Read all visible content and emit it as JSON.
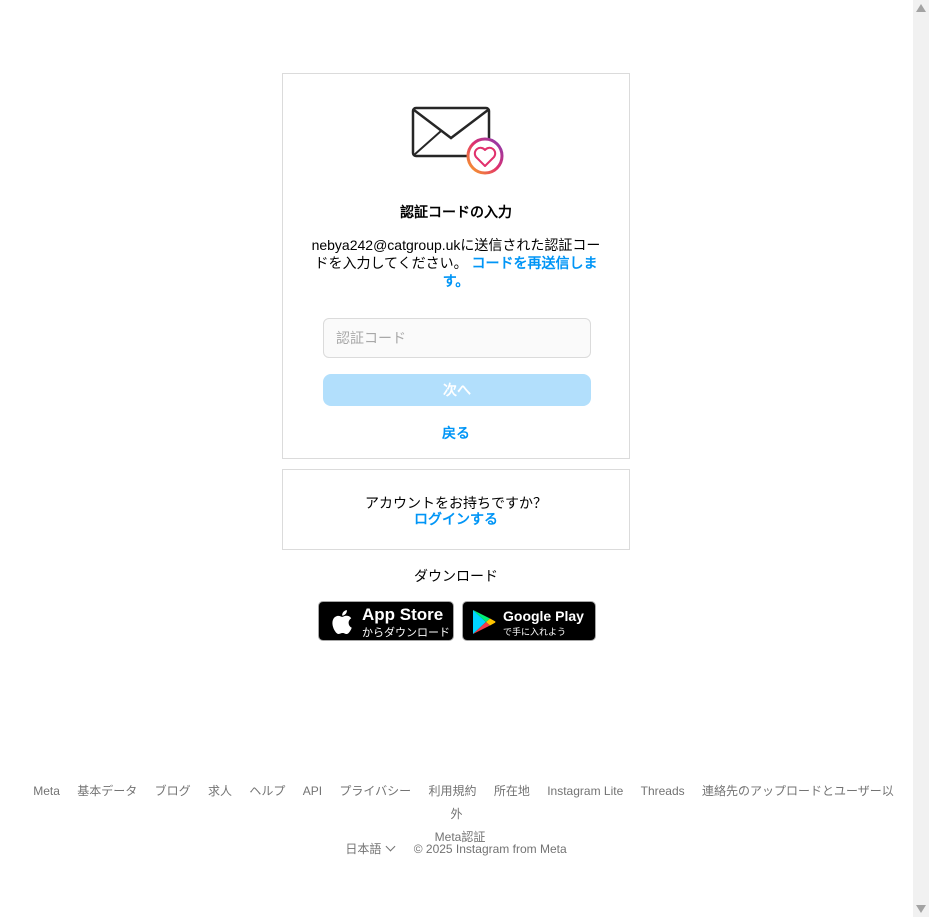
{
  "verify": {
    "title": "認証コードの入力",
    "desc_text": "nebya242@catgroup.ukに送信された認証コードを入力してください。",
    "resend_link": "コードを再送信します。",
    "input_placeholder": "認証コード",
    "input_value": "",
    "next_button": "次へ",
    "back_link": "戻る"
  },
  "login_box": {
    "question": "アカウントをお持ちですか？",
    "login_link": "ログインする"
  },
  "download": {
    "label": "ダウンロード",
    "apple_big": "App Store",
    "apple_small": "からダウンロード",
    "google_big": "Google Play",
    "google_small": "で手に入れよう"
  },
  "footer": {
    "links": [
      "Meta",
      "基本データ",
      "ブログ",
      "求人",
      "ヘルプ",
      "API",
      "プライバシー",
      "利用規約",
      "所在地",
      "Instagram Lite",
      "Threads",
      "連絡先のアップロードとユーザー以外",
      "Meta認証"
    ],
    "language": "日本語",
    "copyright": "© 2025 Instagram from Meta"
  },
  "colors": {
    "link": "#0095f6",
    "button_disabled": "#b2dffc",
    "border": "#dbdbdb"
  }
}
